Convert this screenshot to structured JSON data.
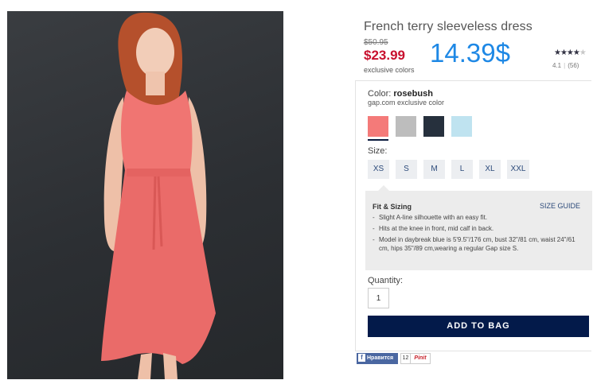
{
  "product": {
    "title": "French terry sleeveless dress",
    "old_price": "$50.95",
    "sale_price": "$23.99",
    "exclusive_note": "exclusive colors",
    "big_price": "14.39$",
    "stars": {
      "filled": "★★★★",
      "empty": "★",
      "rating_fraction": 0.82
    },
    "rating_value": "4.1",
    "review_count": "(56)"
  },
  "color": {
    "label": "Color:",
    "name": "rosebush",
    "subtext": "gap.com exclusive color",
    "swatches": [
      {
        "name": "rosebush",
        "hex": "#f47a79",
        "selected": true
      },
      {
        "name": "heather-grey",
        "hex": "#bdbdbd",
        "selected": false
      },
      {
        "name": "navy",
        "hex": "#26303d",
        "selected": false
      },
      {
        "name": "light-blue",
        "hex": "#bfe3f0",
        "selected": false
      }
    ]
  },
  "size": {
    "label": "Size:",
    "options": [
      "XS",
      "S",
      "M",
      "L",
      "XL",
      "XXL"
    ]
  },
  "fit": {
    "title": "Fit & Sizing",
    "size_guide": "SIZE GUIDE",
    "bullets": [
      "Slight A-line silhouette with an easy fit.",
      "Hits at the knee in front, mid calf in back.",
      "Model in daybreak blue is 5'9.5\"/176 cm, bust 32\"/81 cm, waist 24\"/61 cm, hips 35\"/89 cm,wearing a regular Gap size S."
    ]
  },
  "quantity": {
    "label": "Quantity:",
    "value": "1"
  },
  "add_to_bag": "ADD TO BAG",
  "social": {
    "facebook_icon": "f",
    "facebook_label": "Нравится",
    "count": "12",
    "pinterest_label": "Pinit"
  },
  "colors": {
    "sale_red": "#c8102e",
    "price_blue": "#1e88e5",
    "button_navy": "#031a4a",
    "photo_background": "#2f3236",
    "dress": "#f07572"
  }
}
